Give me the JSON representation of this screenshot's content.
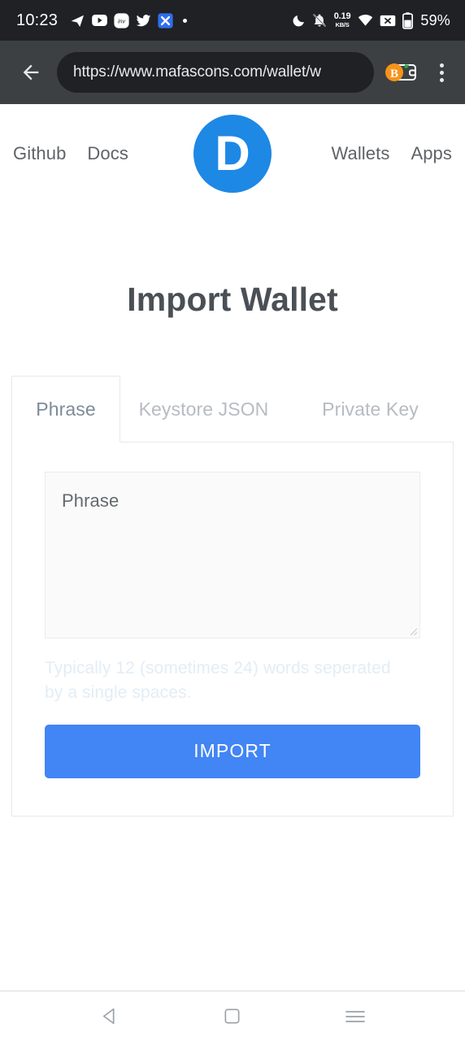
{
  "status_bar": {
    "time": "10:23",
    "notification_icons": [
      "telegram-icon",
      "youtube-icon",
      "inv-app-icon",
      "twitter-icon",
      "x-app-icon",
      "more-notifications-dot"
    ],
    "dnd_icon": "crescent-moon-icon",
    "mute_icon": "bell-muted-icon",
    "network_speed_value": "0.19",
    "network_speed_unit": "KB/S",
    "wifi_icon": "wifi-icon",
    "sim_icon": "no-sim-icon",
    "battery_icon": "battery-icon",
    "battery_percent": "59%",
    "background_color": "#202124"
  },
  "browser": {
    "back_label": "Back",
    "url": "https://www.mafascons.com/wallet/w",
    "extension_icon": "bitcoin-wallet-extension-icon",
    "menu_label": "More options",
    "chrome_color": "#3c4043"
  },
  "site": {
    "nav_left": [
      {
        "label": "Github"
      },
      {
        "label": "Docs"
      }
    ],
    "nav_right": [
      {
        "label": "Wallets"
      },
      {
        "label": "Apps"
      }
    ],
    "logo_letter": "D",
    "logo_color": "#1e88e5",
    "page_title": "Import Wallet"
  },
  "import_form": {
    "tabs": [
      {
        "label": "Phrase",
        "active": true
      },
      {
        "label": "Keystore JSON",
        "active": false
      },
      {
        "label": "Private Key",
        "active": false
      }
    ],
    "phrase_placeholder": "Phrase",
    "helper_text": "Typically 12 (sometimes 24) words seperated by a single spaces.",
    "submit_label": "IMPORT",
    "submit_color": "#4285f4",
    "helper_text_color": "#e2edf5"
  },
  "android_nav": {
    "back_icon": "triangle-back-icon",
    "home_icon": "square-home-icon",
    "recents_icon": "hamburger-recents-icon"
  }
}
